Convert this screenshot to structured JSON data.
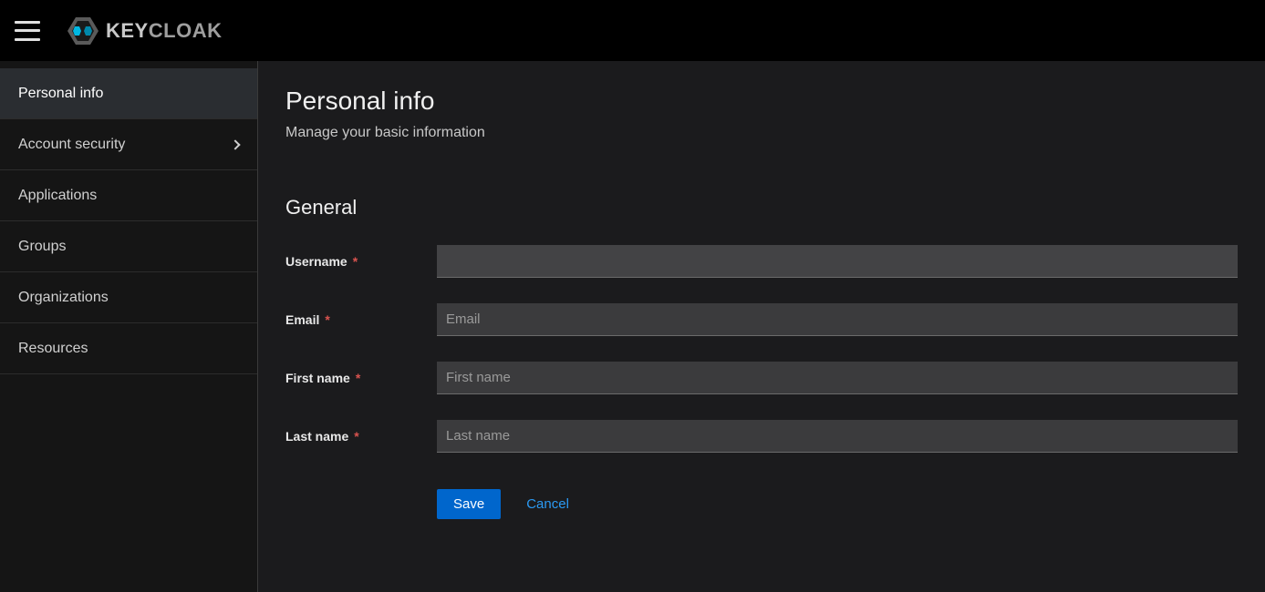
{
  "brand": {
    "name_left": "KEY",
    "name_right": "CLOAK"
  },
  "sidebar": {
    "items": [
      {
        "label": "Personal info",
        "active": true,
        "expandable": false
      },
      {
        "label": "Account security",
        "active": false,
        "expandable": true
      },
      {
        "label": "Applications",
        "active": false,
        "expandable": false
      },
      {
        "label": "Groups",
        "active": false,
        "expandable": false
      },
      {
        "label": "Organizations",
        "active": false,
        "expandable": false
      },
      {
        "label": "Resources",
        "active": false,
        "expandable": false
      }
    ]
  },
  "page": {
    "title": "Personal info",
    "subtitle": "Manage your basic information",
    "section": "General"
  },
  "form": {
    "username": {
      "label": "Username",
      "required": true,
      "value": "",
      "placeholder": ""
    },
    "email": {
      "label": "Email",
      "required": true,
      "value": "",
      "placeholder": "Email"
    },
    "first_name": {
      "label": "First name",
      "required": true,
      "value": "",
      "placeholder": "First name"
    },
    "last_name": {
      "label": "Last name",
      "required": true,
      "value": "",
      "placeholder": "Last name"
    }
  },
  "actions": {
    "save": "Save",
    "cancel": "Cancel"
  },
  "marker": {
    "required": "*"
  }
}
